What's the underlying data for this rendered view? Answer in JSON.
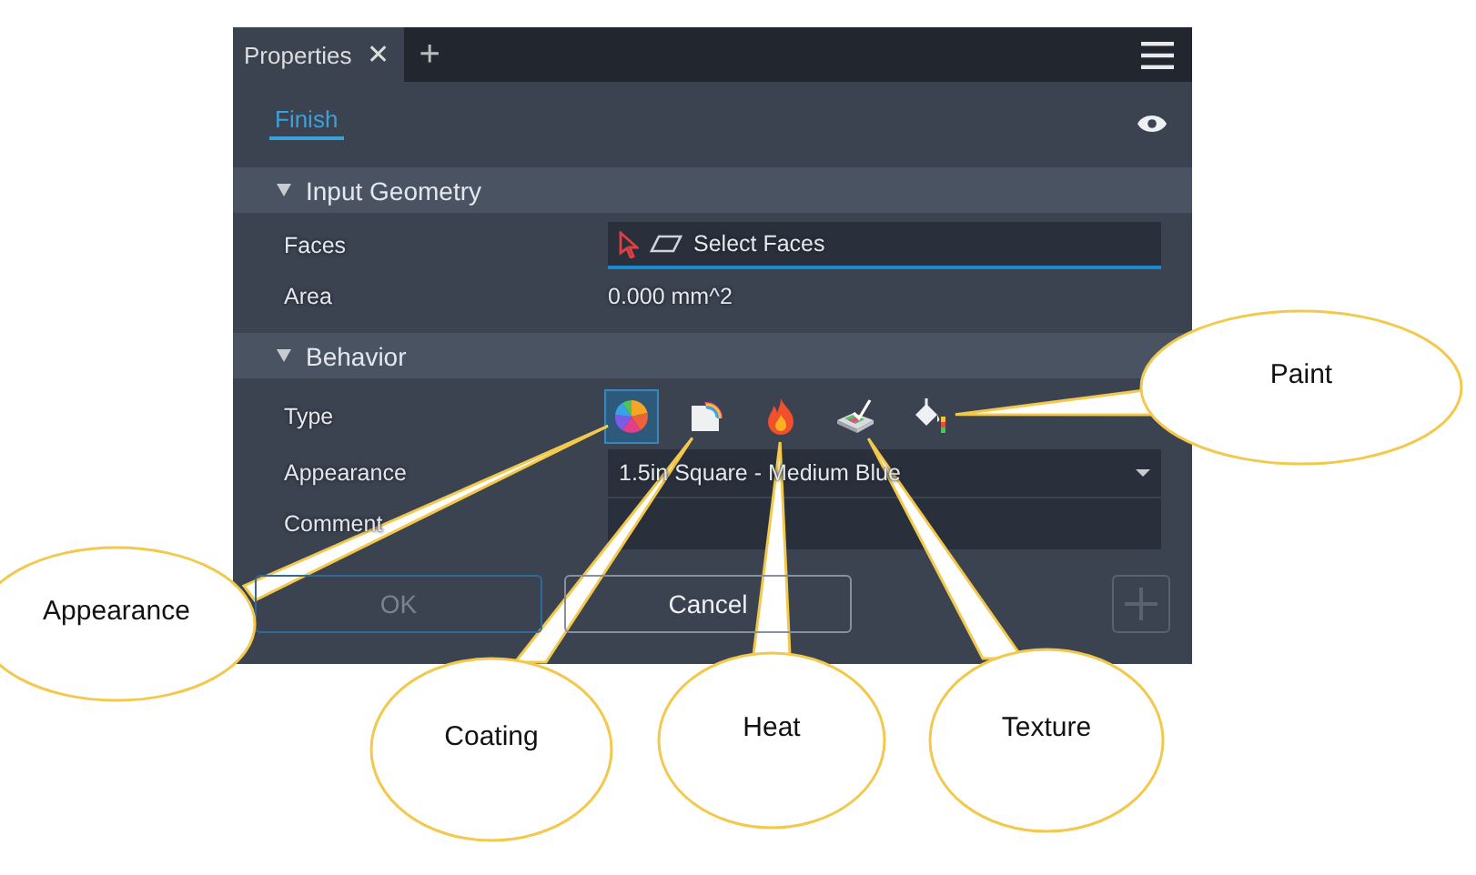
{
  "window": {
    "tabs": [
      {
        "label": "Properties",
        "close": "✕",
        "selected": true
      }
    ],
    "add_tab": "+"
  },
  "subtabs": [
    {
      "label": "Finish",
      "selected": true
    }
  ],
  "sections": [
    {
      "title": "Input Geometry",
      "expanded": true,
      "rows": [
        {
          "kind": "picker",
          "label": "Faces",
          "value": "Select Faces"
        },
        {
          "kind": "text",
          "label": "Area",
          "value": "0.000 mm^2"
        }
      ]
    },
    {
      "title": "Behavior",
      "expanded": true,
      "rows": [
        {
          "kind": "icons",
          "label": "Type",
          "options": [
            {
              "kind": "appearance",
              "selected": true
            },
            {
              "kind": "coating",
              "selected": false
            },
            {
              "kind": "heat",
              "selected": false
            },
            {
              "kind": "texture",
              "selected": false
            },
            {
              "kind": "paint",
              "selected": false
            }
          ]
        },
        {
          "kind": "dropdown",
          "label": "Appearance",
          "value": "1.5in Square - Medium Blue"
        },
        {
          "kind": "field",
          "label": "Comment"
        }
      ]
    }
  ],
  "buttons": [
    {
      "label": "OK",
      "disabled": true
    },
    {
      "label": "Cancel",
      "disabled": false
    }
  ],
  "add_button": {
    "disabled": true
  },
  "callouts": [
    {
      "text": "Paint"
    },
    {
      "text": "Appearance"
    },
    {
      "text": "Coating"
    },
    {
      "text": "Heat"
    },
    {
      "text": "Texture"
    }
  ]
}
